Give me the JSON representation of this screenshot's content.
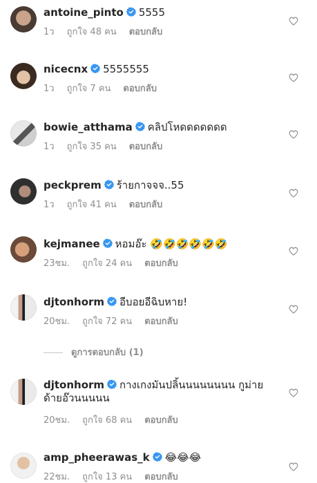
{
  "comments": [
    {
      "username": "antoine_pinto",
      "text": "5555",
      "time": "1ว",
      "likes": "ถูกใจ 48 คน",
      "reply": "ตอบกลับ"
    },
    {
      "username": "nicecnx",
      "text": "5555555",
      "time": "1ว",
      "likes": "ถูกใจ 7 คน",
      "reply": "ตอบกลับ"
    },
    {
      "username": "bowie_atthama",
      "text": "คลิปโหดดดดดดด",
      "time": "1ว",
      "likes": "ถูกใจ 35 คน",
      "reply": "ตอบกลับ"
    },
    {
      "username": "peckprem",
      "text": "ร้ายกาจจจ..55",
      "time": "1ว",
      "likes": "ถูกใจ 41 คน",
      "reply": "ตอบกลับ"
    },
    {
      "username": "kejmanee",
      "text": "หอมอ๊ะ 🤣🤣🤣🤣🤣🤣",
      "time": "23ชม.",
      "likes": "ถูกใจ 24 คน",
      "reply": "ตอบกลับ"
    },
    {
      "username": "djtonhorm",
      "text": "อีบอยอีฉิบหาย!",
      "time": "20ชม.",
      "likes": "ถูกใจ 72 คน",
      "reply": "ตอบกลับ"
    }
  ],
  "view_replies": "ดูการตอบกลับ (1)",
  "reply_comment": {
    "username": "djtonhorm",
    "text": "กางเกงมันปลิ้นนนนนนนน กูม่ายด้ายอ๊วนนนนน",
    "time": "20ชม.",
    "likes": "ถูกใจ 68 คน",
    "reply": "ตอบกลับ"
  },
  "last_comment": {
    "username": "amp_pheerawas_k",
    "text": "😂😂😂",
    "time": "22ชม.",
    "likes": "ถูกใจ 13 คน",
    "reply": "ตอบกลับ"
  },
  "colors": {
    "verified": "#3897f0",
    "secondary_text": "#8e8e8e",
    "primary_text": "#262626"
  }
}
